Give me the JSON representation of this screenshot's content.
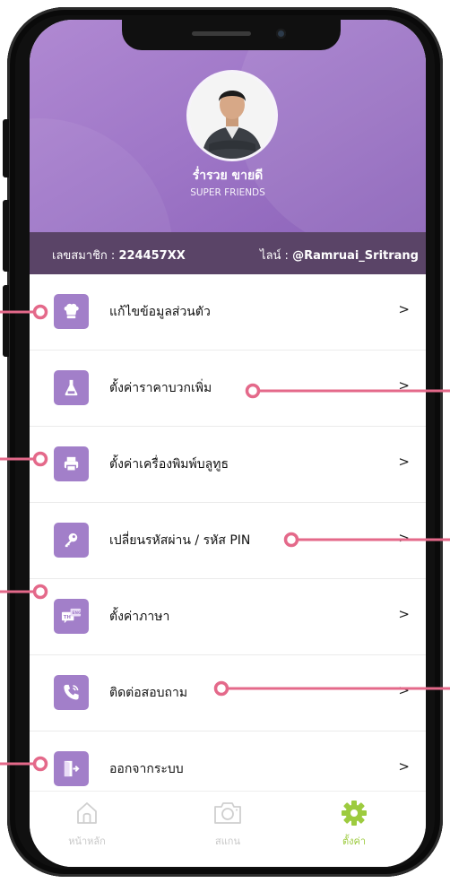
{
  "colors": {
    "header_purple": "#9e76c7",
    "icon_purple": "#a27fc9",
    "member_bar": "#5a4467",
    "active_tab": "#9dcb3f",
    "annotation_pink": "#e4698a"
  },
  "profile": {
    "name": "ร่ำรวย ขายดี",
    "subtitle": "SUPER FRIENDS"
  },
  "member_bar": {
    "member_label": "เลขสมาชิก : ",
    "member_id": "224457XX",
    "line_label": "ไลน์ : ",
    "line_id": "@Ramruai_Sritrang"
  },
  "menu": {
    "items": [
      {
        "label": "แก้ไขข้อมูลส่วนตัว",
        "icon": "chef-hat-icon",
        "chevron": ">"
      },
      {
        "label": "ตั้งค่าราคาบวกเพิ่ม",
        "icon": "flask-icon",
        "chevron": ">"
      },
      {
        "label": "ตั้งค่าเครื่องพิมพ์บลูทูธ",
        "icon": "printer-icon",
        "chevron": ">"
      },
      {
        "label": "เปลี่ยนรหัสผ่าน / รหัส PIN",
        "icon": "key-icon",
        "chevron": ">"
      },
      {
        "label": "ตั้งค่าภาษา",
        "icon": "language-icon",
        "chevron": ">"
      },
      {
        "label": "ติดต่อสอบถาม",
        "icon": "phone-icon",
        "chevron": ">"
      },
      {
        "label": "ออกจากระบบ",
        "icon": "logout-icon",
        "chevron": ">"
      }
    ]
  },
  "tabbar": {
    "tabs": [
      {
        "label": "หน้าหลัก",
        "icon": "home-icon",
        "active": false
      },
      {
        "label": "สแกน",
        "icon": "camera-icon",
        "active": false
      },
      {
        "label": "ตั้งค่า",
        "icon": "gear-icon",
        "active": true
      }
    ]
  }
}
